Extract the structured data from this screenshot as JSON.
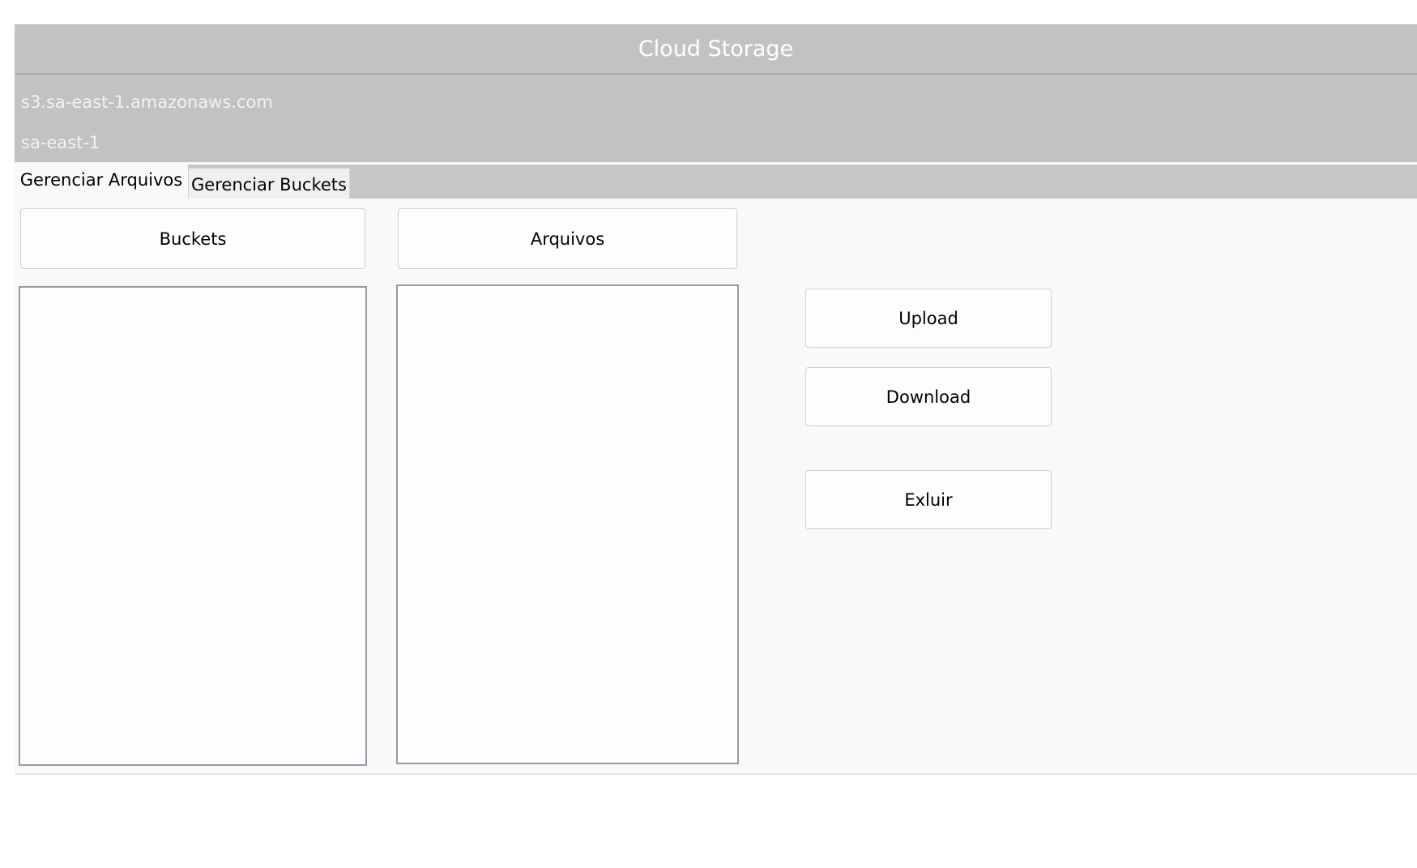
{
  "window": {
    "title": "Cloud Storage"
  },
  "connection": {
    "endpoint": "s3.sa-east-1.amazonaws.com",
    "region": "sa-east-1"
  },
  "tabs": [
    {
      "label": "Gerenciar Arquivos",
      "active": true
    },
    {
      "label": "Gerenciar Buckets",
      "active": false
    }
  ],
  "file_manager": {
    "buckets_button": "Buckets",
    "files_button": "Arquivos",
    "buckets_list": [],
    "files_list": [],
    "actions": {
      "upload": "Upload",
      "download": "Download",
      "delete": "Exluir"
    }
  },
  "colors": {
    "header_bg": "#c2c2c2",
    "header_text": "#ffffff",
    "content_bg": "#f9f9f9",
    "list_border": "#9b98a8"
  }
}
